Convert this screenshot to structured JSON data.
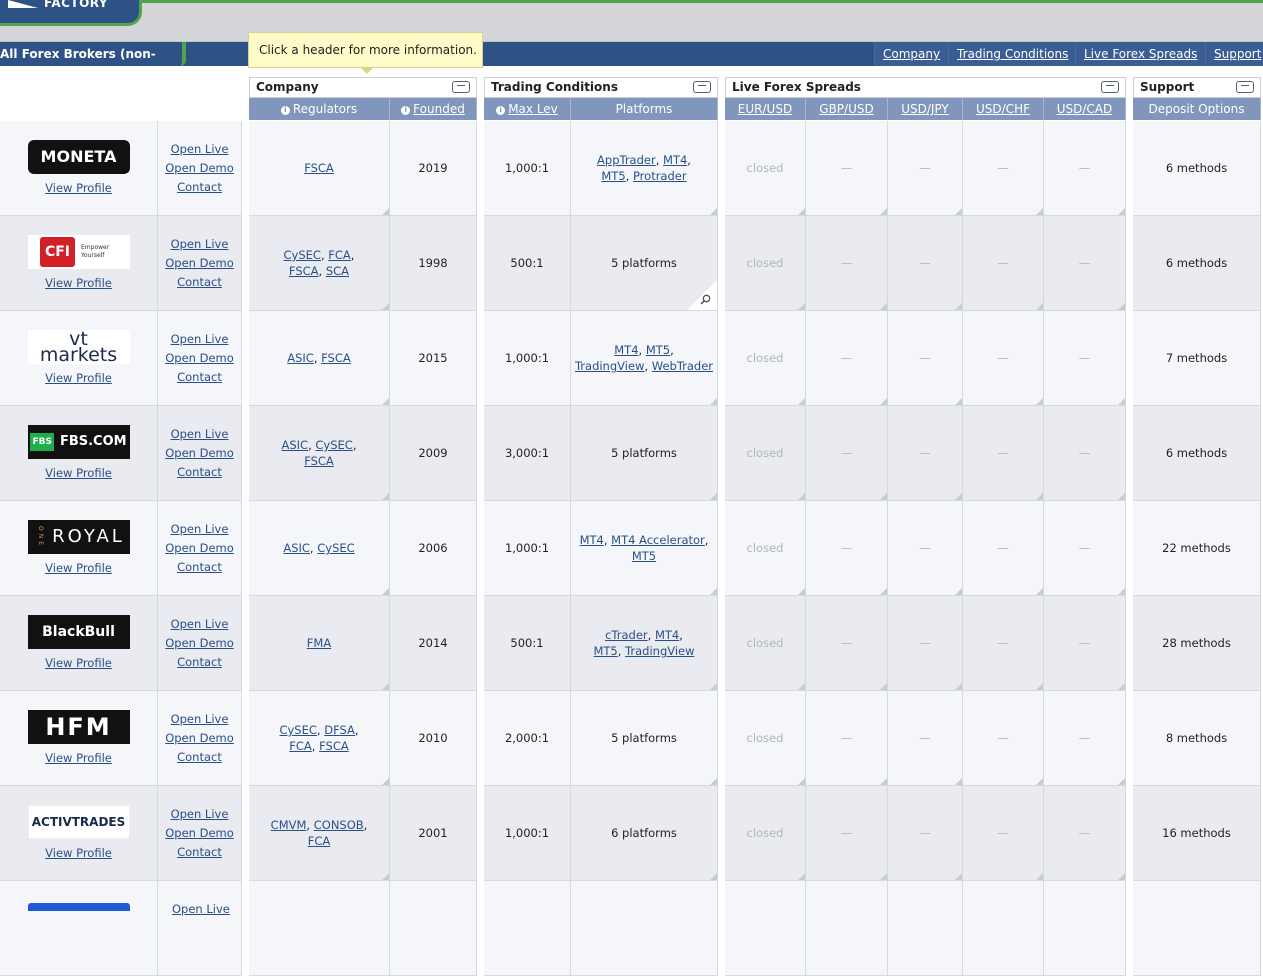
{
  "logo": {
    "text": "FACTORY"
  },
  "navbar": {
    "title": "All Forex Brokers (non-US)",
    "links": [
      "Company",
      "Trading Conditions",
      "Live Forex Spreads",
      "Support"
    ]
  },
  "tooltip": "Click a header for more information.",
  "groups": {
    "company": "Company",
    "trading": "Trading Conditions",
    "spreads": "Live Forex Spreads",
    "support": "Support"
  },
  "columns": {
    "regulators": "Regulators",
    "founded": "Founded",
    "max_lev": "Max Lev",
    "platforms": "Platforms",
    "eurusd": "EUR/USD",
    "gbpusd": "GBP/USD",
    "usdjpy": "USD/JPY",
    "usdchf": "USD/CHF",
    "usdcad": "USD/CAD",
    "deposit": "Deposit Options"
  },
  "actions": {
    "open_live": "Open Live",
    "open_demo": "Open Demo",
    "contact": "Contact",
    "view_profile": "View Profile"
  },
  "spread_closed": "closed",
  "spread_dash": "—",
  "brokers": [
    {
      "logo": "MONETA",
      "regulators": [
        "FSCA"
      ],
      "founded": "2019",
      "max_lev": "1,000:1",
      "platforms": [
        "AppTrader",
        "MT4",
        "MT5",
        "Protrader"
      ],
      "deposit": "6 methods"
    },
    {
      "logo": "CFI",
      "logo_sub": "Empower Yourself",
      "regulators": [
        "CySEC",
        "FCA",
        "FSCA",
        "SCA"
      ],
      "founded": "1998",
      "max_lev": "500:1",
      "platforms_text": "5 platforms",
      "deposit": "6 methods"
    },
    {
      "logo": "vt markets",
      "regulators": [
        "ASIC",
        "FSCA"
      ],
      "founded": "2015",
      "max_lev": "1,000:1",
      "platforms": [
        "MT4",
        "MT5",
        "TradingView",
        "WebTrader"
      ],
      "deposit": "7 methods"
    },
    {
      "logo": "FBS.COM",
      "logo_badge": "FBS",
      "regulators": [
        "ASIC",
        "CySEC",
        "FSCA"
      ],
      "founded": "2009",
      "max_lev": "3,000:1",
      "platforms_text": "5 platforms",
      "deposit": "6 methods"
    },
    {
      "logo": "ROYAL",
      "logo_badge": "ONE",
      "regulators": [
        "ASIC",
        "CySEC"
      ],
      "founded": "2006",
      "max_lev": "1,000:1",
      "platforms": [
        "MT4",
        "MT4 Accelerator",
        "MT5"
      ],
      "deposit": "22 methods"
    },
    {
      "logo": "BlackBull",
      "regulators": [
        "FMA"
      ],
      "founded": "2014",
      "max_lev": "500:1",
      "platforms": [
        "cTrader",
        "MT4",
        "MT5",
        "TradingView"
      ],
      "deposit": "28 methods"
    },
    {
      "logo": "HFM",
      "regulators": [
        "CySEC",
        "DFSA",
        "FCA",
        "FSCA"
      ],
      "founded": "2010",
      "max_lev": "2,000:1",
      "platforms_text": "5 platforms",
      "deposit": "8 methods"
    },
    {
      "logo": "ACTIVTRADES",
      "regulators": [
        "CMVM",
        "CONSOB",
        "FCA"
      ],
      "founded": "2001",
      "max_lev": "1,000:1",
      "platforms_text": "6 platforms",
      "deposit": "16 methods"
    }
  ],
  "colors": {
    "nav": "#2f5286",
    "accent_green": "#4fa64a",
    "subheader": "#8196bd",
    "row_alt": "#e9ebf0",
    "row": "#f4f6f9",
    "link": "#2a4f88"
  }
}
